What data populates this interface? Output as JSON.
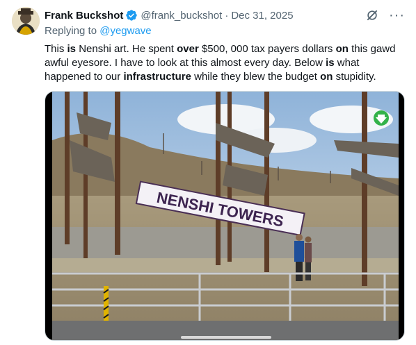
{
  "author": {
    "name": "Frank Buckshot",
    "handle": "@frank_buckshot",
    "separator": "·",
    "date": "Dec 31, 2025"
  },
  "reply": {
    "prefix": "Replying to ",
    "target": "@yegwave"
  },
  "body_segments": [
    {
      "text": "This ",
      "bold": false
    },
    {
      "text": "is",
      "bold": true
    },
    {
      "text": " Nenshi art. He spent ",
      "bold": false
    },
    {
      "text": "over",
      "bold": true
    },
    {
      "text": " $500, 000 tax payers dollars ",
      "bold": false
    },
    {
      "text": "on",
      "bold": true
    },
    {
      "text": " this gawd awful eyesore. I have to look at this almost every day. Below ",
      "bold": false
    },
    {
      "text": "is",
      "bold": true
    },
    {
      "text": " what happened to our ",
      "bold": false
    },
    {
      "text": "infrastructure",
      "bold": true
    },
    {
      "text": " while they blew the budget ",
      "bold": false
    },
    {
      "text": "on",
      "bold": true
    },
    {
      "text": " stupidity.",
      "bold": false
    }
  ],
  "media": {
    "banner_text": "NENSHI TOWERS"
  },
  "icons": {
    "verified": "verified-badge-icon",
    "grok": "grok-icon",
    "more": "more-icon",
    "download": "download-icon"
  },
  "colors": {
    "accent": "#1d9bf0",
    "secondary_text": "#536471",
    "download_badge": "#33b249"
  }
}
